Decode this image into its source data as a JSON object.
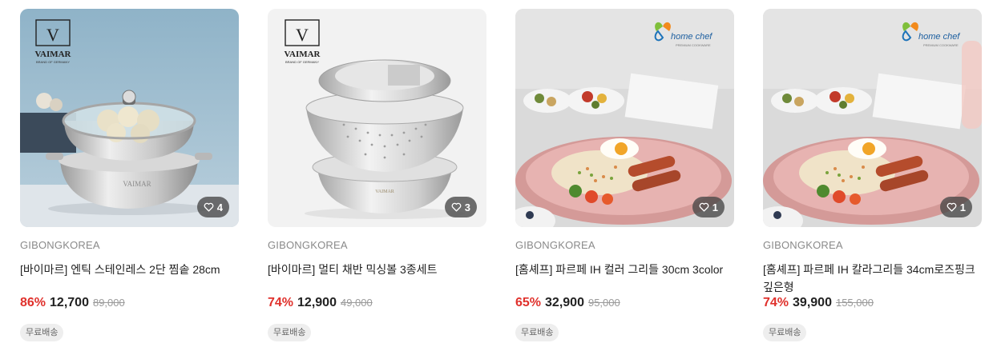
{
  "products": [
    {
      "brand": "GIBONGKOREA",
      "name": "[바이마르] 엔틱 스테인레스 2단 찜솥 28cm",
      "discount": "86%",
      "price": "12,700",
      "original_price": "89,000",
      "shipping_badge": "무료배송",
      "likes": "4",
      "image_logo": "VAIMAR"
    },
    {
      "brand": "GIBONGKOREA",
      "name": "[바이마르] 멀티 채반 믹싱볼 3종세트",
      "discount": "74%",
      "price": "12,900",
      "original_price": "49,000",
      "shipping_badge": "무료배송",
      "likes": "3",
      "image_logo": "VAIMAR"
    },
    {
      "brand": "GIBONGKOREA",
      "name": "[홈셰프] 파르페 IH 컬러 그리들 30cm 3color",
      "discount": "65%",
      "price": "32,900",
      "original_price": "95,000",
      "shipping_badge": "무료배송",
      "likes": "1",
      "image_logo": "home chef"
    },
    {
      "brand": "GIBONGKOREA",
      "name": "[홈셰프] 파르페 IH 칼라그리들 34cm로즈핑크 깊은형",
      "discount": "74%",
      "price": "39,900",
      "original_price": "155,000",
      "shipping_badge": "무료배송",
      "likes": "1",
      "image_logo": "home chef"
    }
  ],
  "icons": {
    "like": "heart-outline-icon"
  },
  "colors": {
    "discount": "#e0312c",
    "badge_bg": "#eeeeee",
    "brand_text": "#8a8a8a"
  }
}
